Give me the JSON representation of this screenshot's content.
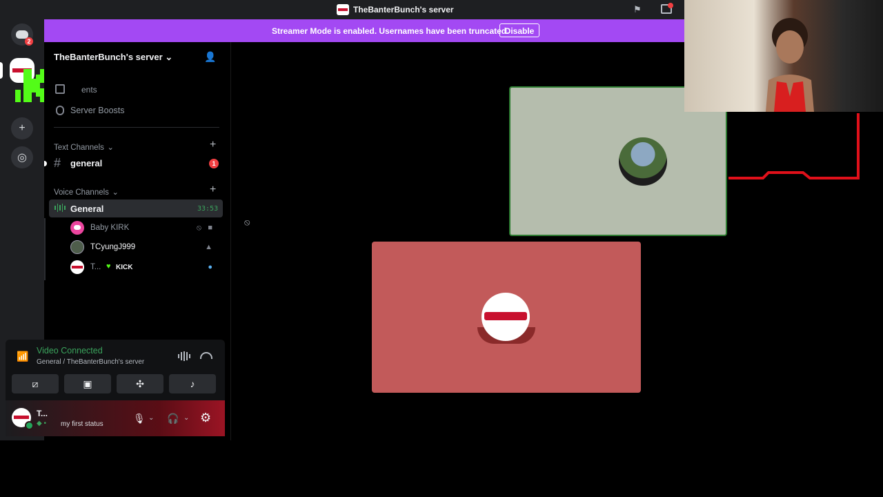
{
  "window": {
    "title": "TheBanterBunch's server"
  },
  "banner": {
    "text": "Streamer Mode is enabled. Usernames have been truncated.",
    "button": "Disable"
  },
  "rail": {
    "home_badge": "2",
    "overlay_count": "5"
  },
  "sidebar": {
    "server_name": "TheBanterBunch's server",
    "events_label": "Events",
    "events_visible_label": "ents",
    "server_boosts": "Server Boosts",
    "text_category": "Text Channels",
    "text_channel": "general",
    "text_channel_badge": "1",
    "voice_category": "Voice Channels",
    "voice_channel": "General",
    "voice_timer": "33:53",
    "members": [
      {
        "name": "Baby KIRK"
      },
      {
        "name": "TCyungJ999"
      },
      {
        "name": "T...",
        "tag": "KICK"
      }
    ]
  },
  "voice_panel": {
    "status": "Video Connected",
    "location": "General / TheBanterBunch's server"
  },
  "user_panel": {
    "name": "T...",
    "status": "my first status"
  },
  "colors": {
    "banner": "#a349f3",
    "connected_green": "#3ba55d",
    "badge_red": "#f23f42",
    "tile_speaking_border": "#2e7d32",
    "tile2_bg": "#c25a5a"
  }
}
